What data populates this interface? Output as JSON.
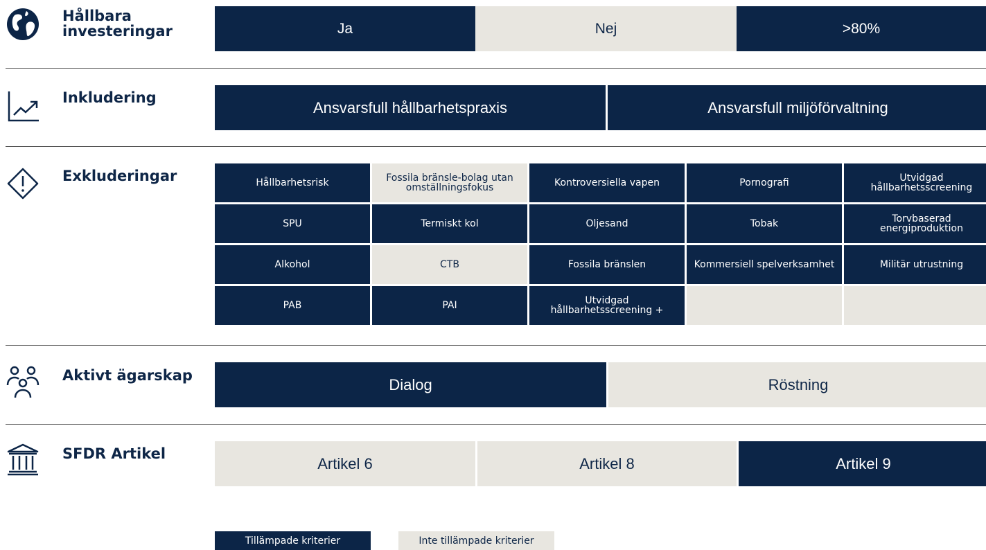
{
  "sections": {
    "sustainable": {
      "title_line1": "Hållbara",
      "title_line2": "investeringar",
      "items": [
        {
          "label": "Ja",
          "applied": true
        },
        {
          "label": "Nej",
          "applied": false
        },
        {
          "label": ">80%",
          "applied": true
        }
      ]
    },
    "inclusion": {
      "title": "Inkludering",
      "items": [
        {
          "label": "Ansvarsfull hållbarhetspraxis",
          "applied": true
        },
        {
          "label": "Ansvarsfull miljöförvaltning",
          "applied": true
        }
      ]
    },
    "exclusions": {
      "title": "Exkluderingar",
      "items": [
        {
          "label": "Hållbarhetsrisk",
          "applied": true
        },
        {
          "label": "Fossila bränsle-bolag utan omställningsfokus",
          "applied": false
        },
        {
          "label": "Kontroversiella vapen",
          "applied": true
        },
        {
          "label": "Pornografi",
          "applied": true
        },
        {
          "label": "Utvidgad hållbarhetsscreening",
          "applied": true
        },
        {
          "label": "SPU",
          "applied": true
        },
        {
          "label": "Termiskt kol",
          "applied": true
        },
        {
          "label": "Oljesand",
          "applied": true
        },
        {
          "label": "Tobak",
          "applied": true
        },
        {
          "label": "Torvbaserad energiproduktion",
          "applied": true
        },
        {
          "label": "Alkohol",
          "applied": true
        },
        {
          "label": "CTB",
          "applied": false
        },
        {
          "label": "Fossila bränslen",
          "applied": true
        },
        {
          "label": "Kommersiell spelverksamhet",
          "applied": true
        },
        {
          "label": "Militär utrustning",
          "applied": true
        },
        {
          "label": "PAB",
          "applied": true
        },
        {
          "label": "PAI",
          "applied": true
        },
        {
          "label": "Utvidgad hållbarhetsscreening +",
          "applied": true
        },
        {
          "label": "",
          "applied": false
        },
        {
          "label": "",
          "applied": false
        }
      ]
    },
    "ownership": {
      "title": "Aktivt ägarskap",
      "items": [
        {
          "label": "Dialog",
          "applied": true
        },
        {
          "label": "Röstning",
          "applied": false
        }
      ]
    },
    "sfdr": {
      "title": "SFDR Artikel",
      "items": [
        {
          "label": "Artikel 6",
          "applied": false
        },
        {
          "label": "Artikel 8",
          "applied": false
        },
        {
          "label": "Artikel 9",
          "applied": true
        }
      ]
    }
  },
  "legend": {
    "applied": "Tillämpade kriterier",
    "not_applied": "Inte tillämpade kriterier"
  },
  "icons": {
    "sustainable": "globe-icon",
    "inclusion": "trend-chart-icon",
    "exclusions": "warning-diamond-icon",
    "ownership": "people-group-icon",
    "sfdr": "bank-building-icon"
  },
  "colors": {
    "applied": "#0c2547",
    "not_applied": "#e8e6e0",
    "text_dark": "#0e2647"
  }
}
